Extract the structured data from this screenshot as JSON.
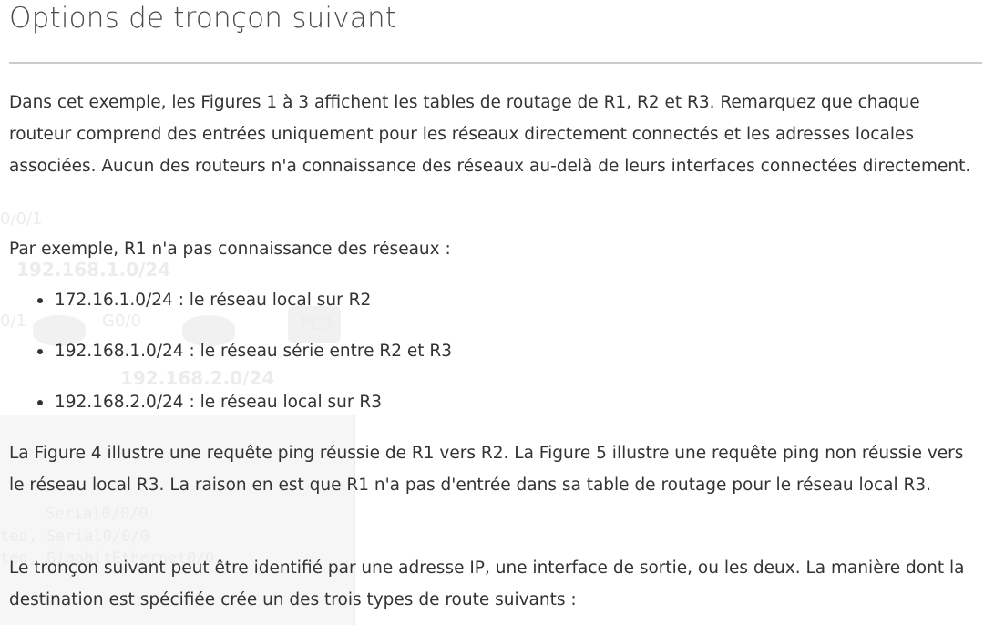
{
  "header": {
    "title": "Options de tronçon suivant"
  },
  "paragraphs": [
    "Dans cet exemple, les Figures 1 à 3 affichent les tables de routage de R1, R2 et R3. Remarquez que chaque routeur comprend des entrées uniquement pour les réseaux directement connectés et les adresses locales associées. Aucun des routeurs n'a connaissance des réseaux au-delà de leurs interfaces connectées directement.",
    "Par exemple, R1 n'a pas connaissance des réseaux :",
    "La Figure 4 illustre une requête ping réussie de R1 vers R2. La Figure 5 illustre une requête ping non réussie vers le réseau local R3. La raison en est que R1 n'a pas d'entrée dans sa table de routage pour le réseau local R3.",
    "Le tronçon suivant peut être identifié par une adresse IP, une interface de sortie, ou les deux. La manière dont la destination est spécifiée crée un des trois types de route suivants :"
  ],
  "bullets": [
    "172.16.1.0/24 : le réseau local sur R2",
    "192.168.1.0/24 : le réseau série entre R2 et R3",
    "192.168.2.0/24 : le réseau local sur R3"
  ],
  "background_ghost": {
    "labels": [
      "0/0/1",
      "192.168.1.0/24",
      "0/1",
      "G0/0",
      "192.168.2.0/24",
      "PC3"
    ],
    "terminal_lines": [
      "  Serial0/0/0",
      "ted, Serial0/0/0",
      "ted, GigabitEthernet0/0"
    ]
  }
}
